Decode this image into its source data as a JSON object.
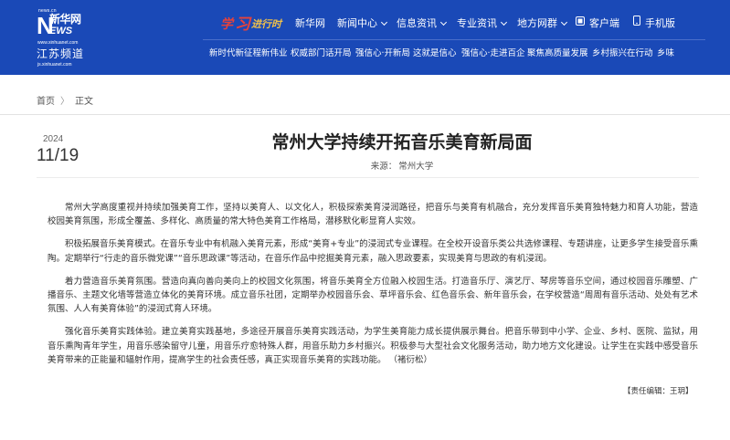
{
  "logo": {
    "url_top": "news.cn",
    "brand_letter": "N",
    "brand_cn": "新华网",
    "brand_ews": "EWS",
    "url_bottom": "www.xinhuanet.com",
    "channel": "江苏频道",
    "url_channel": "js.xinhuanet.com"
  },
  "slogan": {
    "part1": "学",
    "part2": "习",
    "part3": "进行时"
  },
  "topnav": {
    "items": [
      {
        "label": "新华网"
      },
      {
        "label": "新闻中心"
      },
      {
        "label": "信息资讯"
      },
      {
        "label": "专业资讯"
      },
      {
        "label": "地方网群"
      },
      {
        "label": "客户端"
      },
      {
        "label": "手机版"
      }
    ]
  },
  "subnav": {
    "items": [
      "新时代新征程新伟业",
      "权威部门话开局",
      "强信心·开新局",
      "这就是信心",
      "强信心·走进百企",
      "聚焦高质量发展",
      "乡村振兴在行动",
      "乡味"
    ]
  },
  "breadcrumb": {
    "home": "首页",
    "separator": "〉",
    "current": "正文"
  },
  "article": {
    "year": "2024",
    "month_day": "11/19",
    "title": "常州大学持续开拓音乐美育新局面",
    "source_label": "来源：",
    "source": "常州大学",
    "paragraphs": [
      "常州大学高度重视并持续加强美育工作，坚持以美育人、以文化人，积极探索美育浸润路径，把音乐与美育有机融合，充分发挥音乐美育独特魅力和育人功能，营造校园美育氛围，形成全覆盖、多样化、高质量的常大特色美育工作格局，潜移默化彰显育人实效。",
      "积极拓展音乐美育模式。在音乐专业中有机融入美育元素，形成“美育+专业”的浸润式专业课程。在全校开设音乐类公共选修课程、专题讲座，让更多学生接受音乐熏陶。定期举行“行走的音乐微党课”“音乐思政课”等活动，在音乐作品中挖掘美育元素，融入思政要素，实现美育与思政的有机浸润。",
      "着力营造音乐美育氛围。营造向真向善向美向上的校园文化氛围，将音乐美育全方位融入校园生活。打造音乐厅、演艺厅、琴房等音乐空间，通过校园音乐雕塑、广播音乐、主题文化墙等营造立体化的美育环境。成立音乐社团，定期举办校园音乐会、草坪音乐会、红色音乐会、新年音乐会，在学校营造“周周有音乐活动、处处有艺术氛围、人人有美育体验”的浸润式育人环境。",
      "强化音乐美育实践体验。建立美育实践基地，多途径开展音乐美育实践活动，为学生美育能力成长提供展示舞台。把音乐带到中小学、企业、乡村、医院、监狱，用音乐熏陶青年学生，用音乐感染留守儿童，用音乐疗愈特殊人群，用音乐助力乡村振兴。积极参与大型社会文化服务活动，助力地方文化建设。让学生在实践中感受音乐美育带来的正能量和辐射作用，提高学生的社会责任感，真正实现音乐美育的实践功能。 （褚衍松）"
    ],
    "editor": "【责任编辑：王玥】"
  },
  "colors": {
    "header_bg": "#1a49b7",
    "slogan_red": "#e8423a",
    "slogan_gold": "#f0c04a"
  }
}
